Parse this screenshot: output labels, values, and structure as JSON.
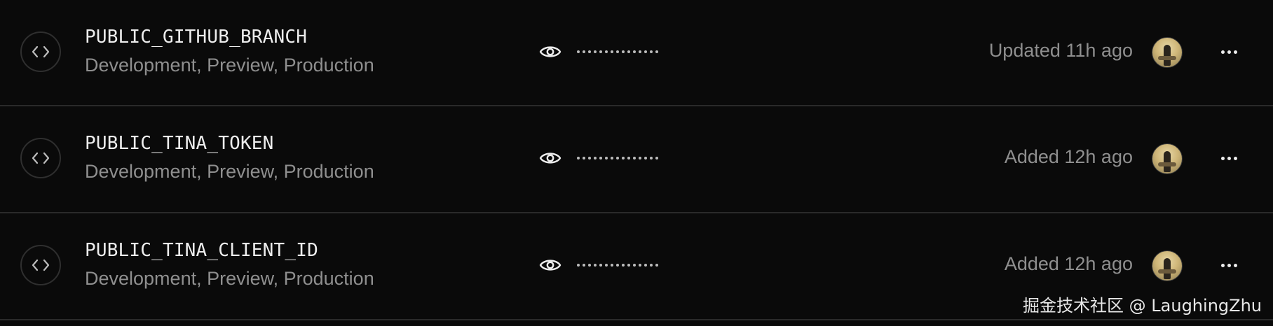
{
  "rows": [
    {
      "name": "PUBLIC_GITHUB_BRANCH",
      "environments": "Development, Preview, Production",
      "masked_value": "•••••••••••••••",
      "status": "Updated 11h ago"
    },
    {
      "name": "PUBLIC_TINA_TOKEN",
      "environments": "Development, Preview, Production",
      "masked_value": "•••••••••••••••",
      "status": "Added 12h ago"
    },
    {
      "name": "PUBLIC_TINA_CLIENT_ID",
      "environments": "Development, Preview, Production",
      "masked_value": "•••••••••••••••",
      "status": "Added 12h ago"
    }
  ],
  "icons": {
    "row_icon": "code-icon",
    "reveal": "eye-icon",
    "menu": "more-horizontal-icon",
    "user": "avatar"
  },
  "colors": {
    "background": "#0a0a0a",
    "divider": "#2a2a2a",
    "primary_text": "#ededed",
    "secondary_text": "#8f8f8f"
  },
  "watermark": "掘金技术社区 @ LaughingZhu"
}
